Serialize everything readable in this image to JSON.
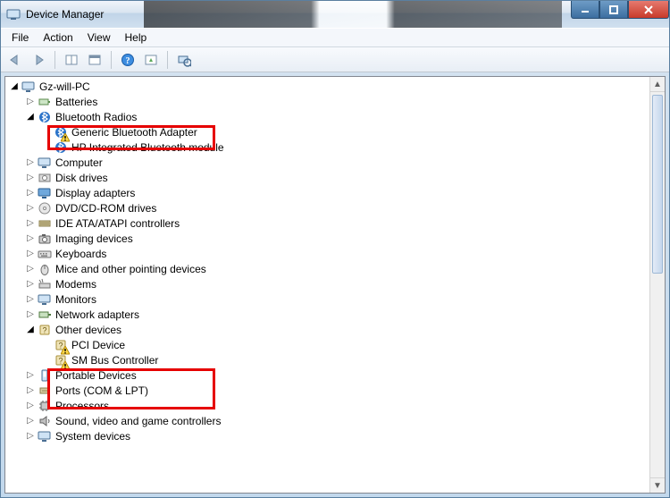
{
  "window": {
    "title": "Device Manager"
  },
  "menu": {
    "file": "File",
    "action": "Action",
    "view": "View",
    "help": "Help"
  },
  "tree": {
    "root": "Gz-will-PC",
    "batteries": "Batteries",
    "bluetooth": "Bluetooth Radios",
    "bt_generic": "Generic Bluetooth Adapter",
    "bt_hp": "HP Integrated Bluetooth module",
    "computer": "Computer",
    "disk": "Disk drives",
    "display": "Display adapters",
    "dvd": "DVD/CD-ROM drives",
    "ide": "IDE ATA/ATAPI controllers",
    "imaging": "Imaging devices",
    "keyboards": "Keyboards",
    "mice": "Mice and other pointing devices",
    "modems": "Modems",
    "monitors": "Monitors",
    "network": "Network adapters",
    "other": "Other devices",
    "pci": "PCI Device",
    "smbus": "SM Bus Controller",
    "portable": "Portable Devices",
    "ports": "Ports (COM & LPT)",
    "processors": "Processors",
    "sound": "Sound, video and game controllers",
    "system": "System devices"
  }
}
